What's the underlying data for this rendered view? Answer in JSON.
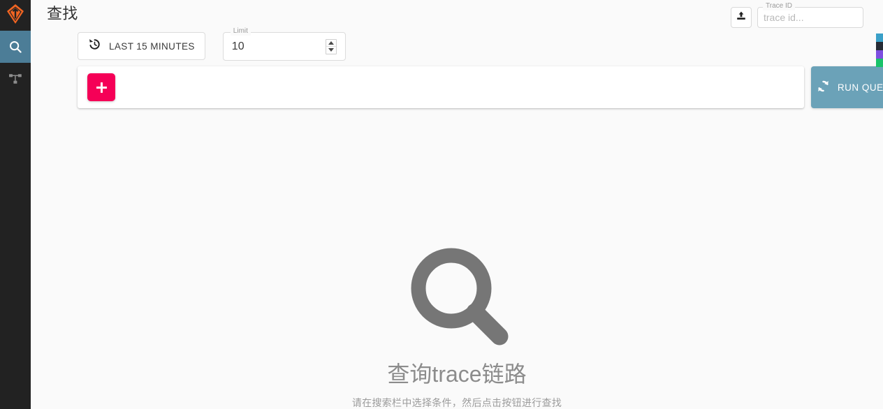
{
  "sidebar": {
    "logo": {
      "icon": "jaeger-logo-icon",
      "color": "#f26522"
    },
    "items": [
      {
        "id": "search",
        "icon": "search-icon",
        "active": true,
        "active_color": "#4c7d97"
      },
      {
        "id": "dependencies",
        "icon": "dependency-graph-icon",
        "active": false
      }
    ]
  },
  "header": {
    "title": "查找",
    "trace_id": {
      "legend": "Trace ID",
      "placeholder": "trace id...",
      "value": ""
    },
    "upload_button": {
      "icon": "upload-icon"
    }
  },
  "controls": {
    "time_range": {
      "icon": "history-icon",
      "label": "LAST 15 MINUTES"
    },
    "limit": {
      "legend": "Limit",
      "value": "10",
      "spinner": {
        "up_icon": "chevron-up-icon",
        "down_icon": "chevron-down-icon"
      }
    }
  },
  "query_bar": {
    "add_button": {
      "icon": "plus-icon",
      "color": "#f50057"
    }
  },
  "run_query": {
    "icon": "refresh-icon",
    "label": "RUN QUERY",
    "color": "#6ba2b8"
  },
  "edge_sliver": {
    "segments": [
      "#3aa0c8",
      "#262b36",
      "#7d4fe0",
      "#19c26a"
    ]
  },
  "empty_state": {
    "icon": "magnifier-icon",
    "icon_color": "#767676",
    "title": "查询trace链路",
    "subtitle": "请在搜索栏中选择条件，然后点击按钮进行查找"
  }
}
